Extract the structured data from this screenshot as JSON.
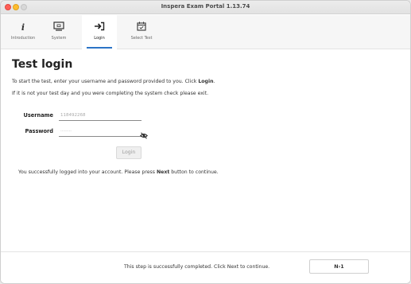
{
  "window": {
    "title": "Inspera Exam Portal 1.13.74"
  },
  "steps": [
    {
      "label": "Introduction",
      "icon": "info-icon"
    },
    {
      "label": "System",
      "icon": "monitor-icon"
    },
    {
      "label": "Login",
      "icon": "login-arrow-icon",
      "active": true
    },
    {
      "label": "Select Test",
      "icon": "calendar-check-icon"
    }
  ],
  "colors": {
    "accent": "#2b74c6",
    "close": "#ff5f57",
    "minimize": "#febc2e"
  },
  "main": {
    "heading": "Test login",
    "instruction_prefix": "To start the test, enter your username and password provided to you. Click ",
    "instruction_bold": "Login",
    "instruction_suffix": ".",
    "exit_note": "If it is not your test day and you were completing the system check please exit."
  },
  "form": {
    "username_label": "Username",
    "username_value": "118492268",
    "password_label": "Password",
    "password_value": "········",
    "login_label": "Login"
  },
  "success": {
    "prefix": "You successfully logged into your account. Please press ",
    "bold": "Next",
    "suffix": " button to continue."
  },
  "footer": {
    "status": "This step is successfully completed. Click Next to continue.",
    "next_label": "N›1"
  }
}
